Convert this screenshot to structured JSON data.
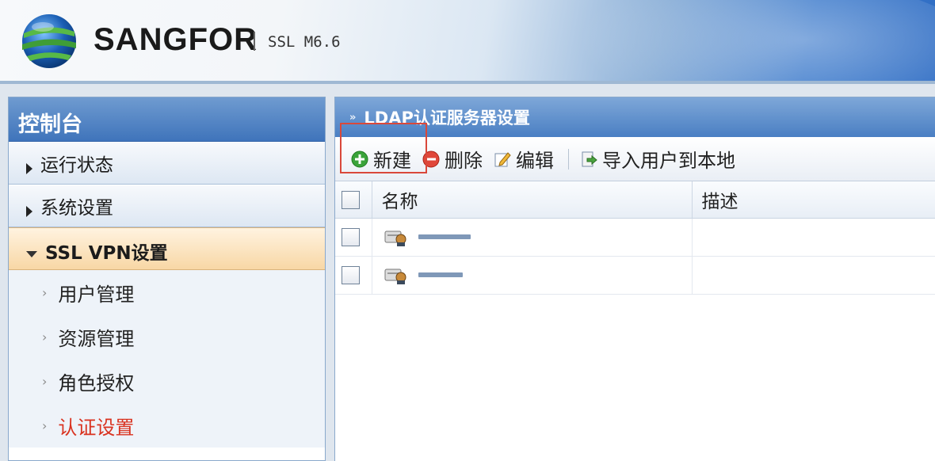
{
  "header": {
    "brand": "SANGFOR",
    "version": "SSL M6.6"
  },
  "sidebar": {
    "title": "控制台",
    "groups": [
      {
        "label": "运行状态",
        "expanded": false
      },
      {
        "label": "系统设置",
        "expanded": false
      },
      {
        "label": "SSL VPN设置",
        "expanded": true
      }
    ],
    "sub_items": [
      {
        "label": "用户管理"
      },
      {
        "label": "资源管理"
      },
      {
        "label": "角色授权"
      },
      {
        "label": "认证设置",
        "selected": true
      }
    ]
  },
  "panel": {
    "title": "LDAP认证服务器设置",
    "toolbar": {
      "new_label": "新建",
      "delete_label": "删除",
      "edit_label": "编辑",
      "import_label": "导入用户到本地"
    },
    "table": {
      "columns": [
        "名称",
        "描述"
      ]
    }
  },
  "colors": {
    "accent_blue": "#4a7fc3",
    "selected_text": "#d9321f",
    "highlight_border": "#d9483a"
  }
}
